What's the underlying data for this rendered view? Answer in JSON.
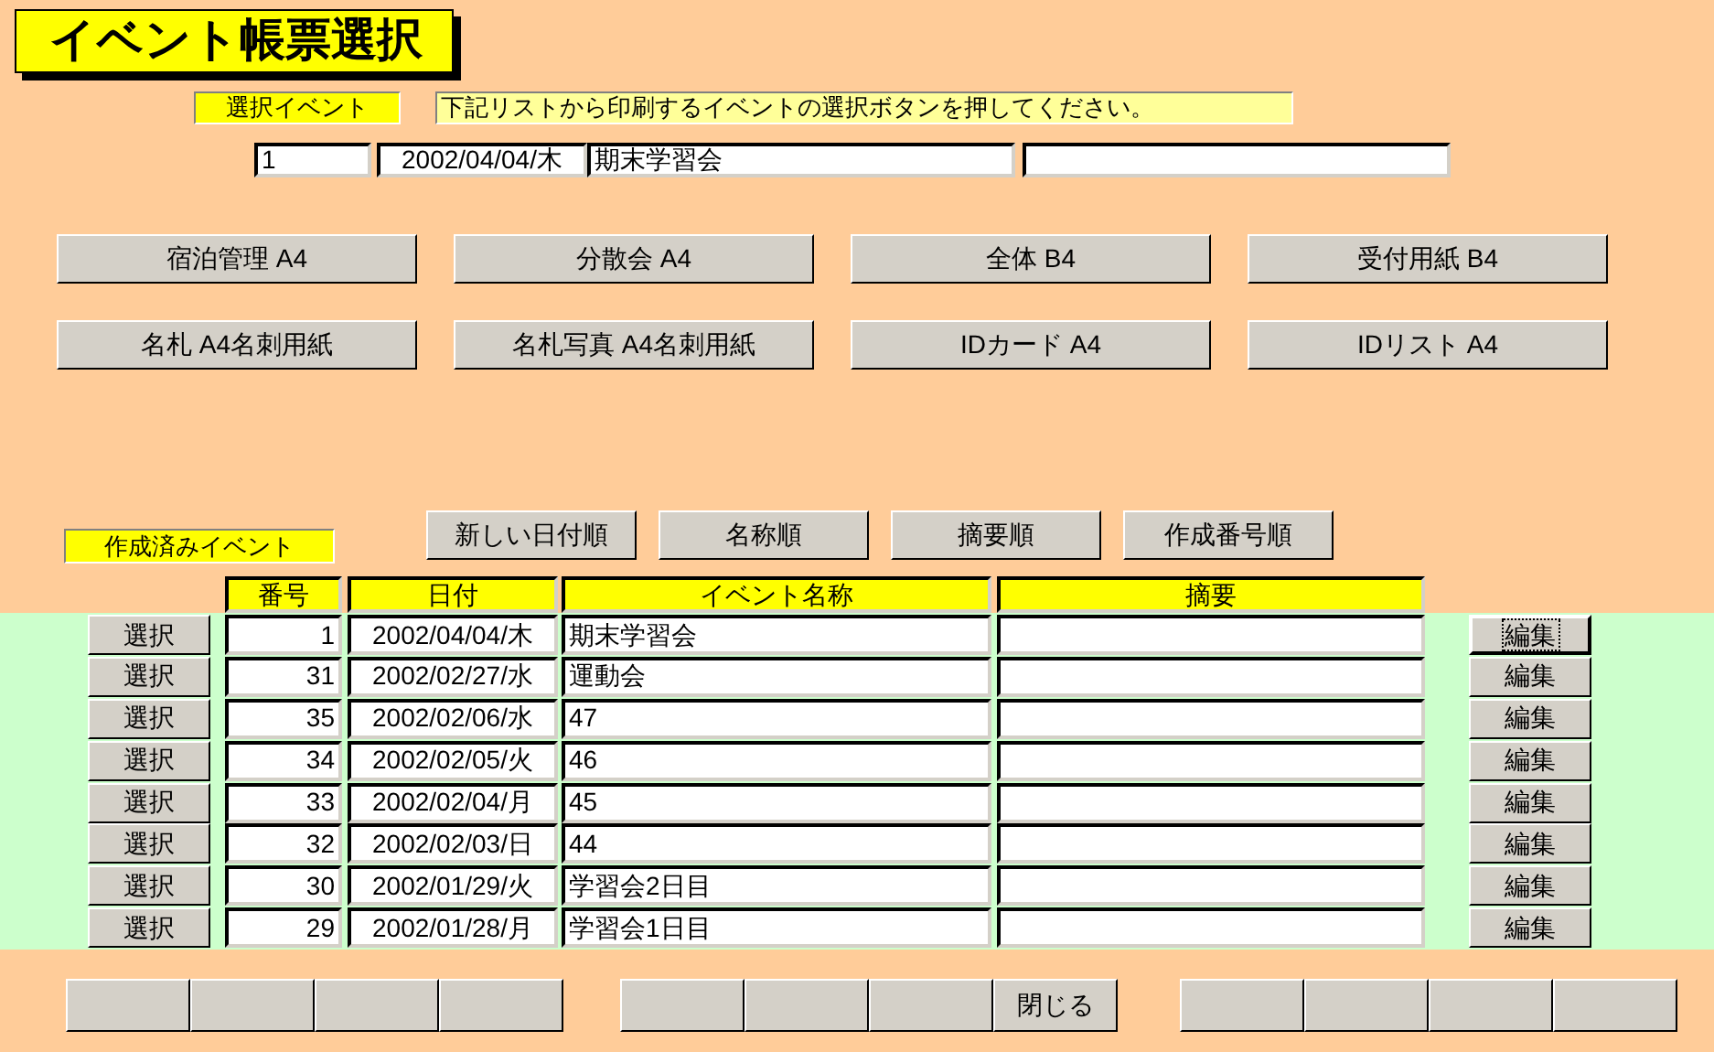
{
  "title": "イベント帳票選択",
  "selected_event": {
    "label": "選択イベント",
    "instruction": "下記リストから印刷するイベントの選択ボタンを押してください。",
    "number": "1",
    "date": "2002/04/04/木",
    "name": "期末学習会"
  },
  "report_buttons": [
    "宿泊管理 A4",
    "分散会 A4",
    "全体 B4",
    "受付用紙 B4",
    "名札 A4名刺用紙",
    "名札写真 A4名刺用紙",
    "IDカード A4",
    "IDリスト A4"
  ],
  "list_label": "作成済みイベント",
  "sort_buttons": [
    "新しい日付順",
    "名称順",
    "摘要順",
    "作成番号順"
  ],
  "table": {
    "columns": [
      "番号",
      "日付",
      "イベント名称",
      "摘要"
    ],
    "rows": [
      {
        "select": "選択",
        "number": "1",
        "date": "2002/04/04/木",
        "name": "期末学習会",
        "edit": "編集",
        "focused": true
      },
      {
        "select": "選択",
        "number": "31",
        "date": "2002/02/27/水",
        "name": "運動会",
        "edit": "編集",
        "focused": false
      },
      {
        "select": "選択",
        "number": "35",
        "date": "2002/02/06/水",
        "name": "47",
        "edit": "編集",
        "focused": false
      },
      {
        "select": "選択",
        "number": "34",
        "date": "2002/02/05/火",
        "name": "46",
        "edit": "編集",
        "focused": false
      },
      {
        "select": "選択",
        "number": "33",
        "date": "2002/02/04/月",
        "name": "45",
        "edit": "編集",
        "focused": false
      },
      {
        "select": "選択",
        "number": "32",
        "date": "2002/02/03/日",
        "name": "44",
        "edit": "編集",
        "focused": false
      },
      {
        "select": "選択",
        "number": "30",
        "date": "2002/01/29/火",
        "name": "学習会2日目",
        "edit": "編集",
        "focused": false
      },
      {
        "select": "選択",
        "number": "29",
        "date": "2002/01/28/月",
        "name": "学習会1日目",
        "edit": "編集",
        "focused": false
      }
    ]
  },
  "bottom_buttons": [
    [
      {
        "kind": "blank"
      },
      {
        "kind": "blank"
      },
      {
        "kind": "blank"
      },
      {
        "kind": "blank"
      }
    ],
    [
      {
        "kind": "blank"
      },
      {
        "kind": "blank"
      },
      {
        "kind": "blank"
      },
      {
        "kind": "labeled",
        "label": "閉じる"
      }
    ],
    [
      {
        "kind": "blank"
      },
      {
        "kind": "blank"
      },
      {
        "kind": "blank"
      },
      {
        "kind": "blank"
      }
    ]
  ]
}
